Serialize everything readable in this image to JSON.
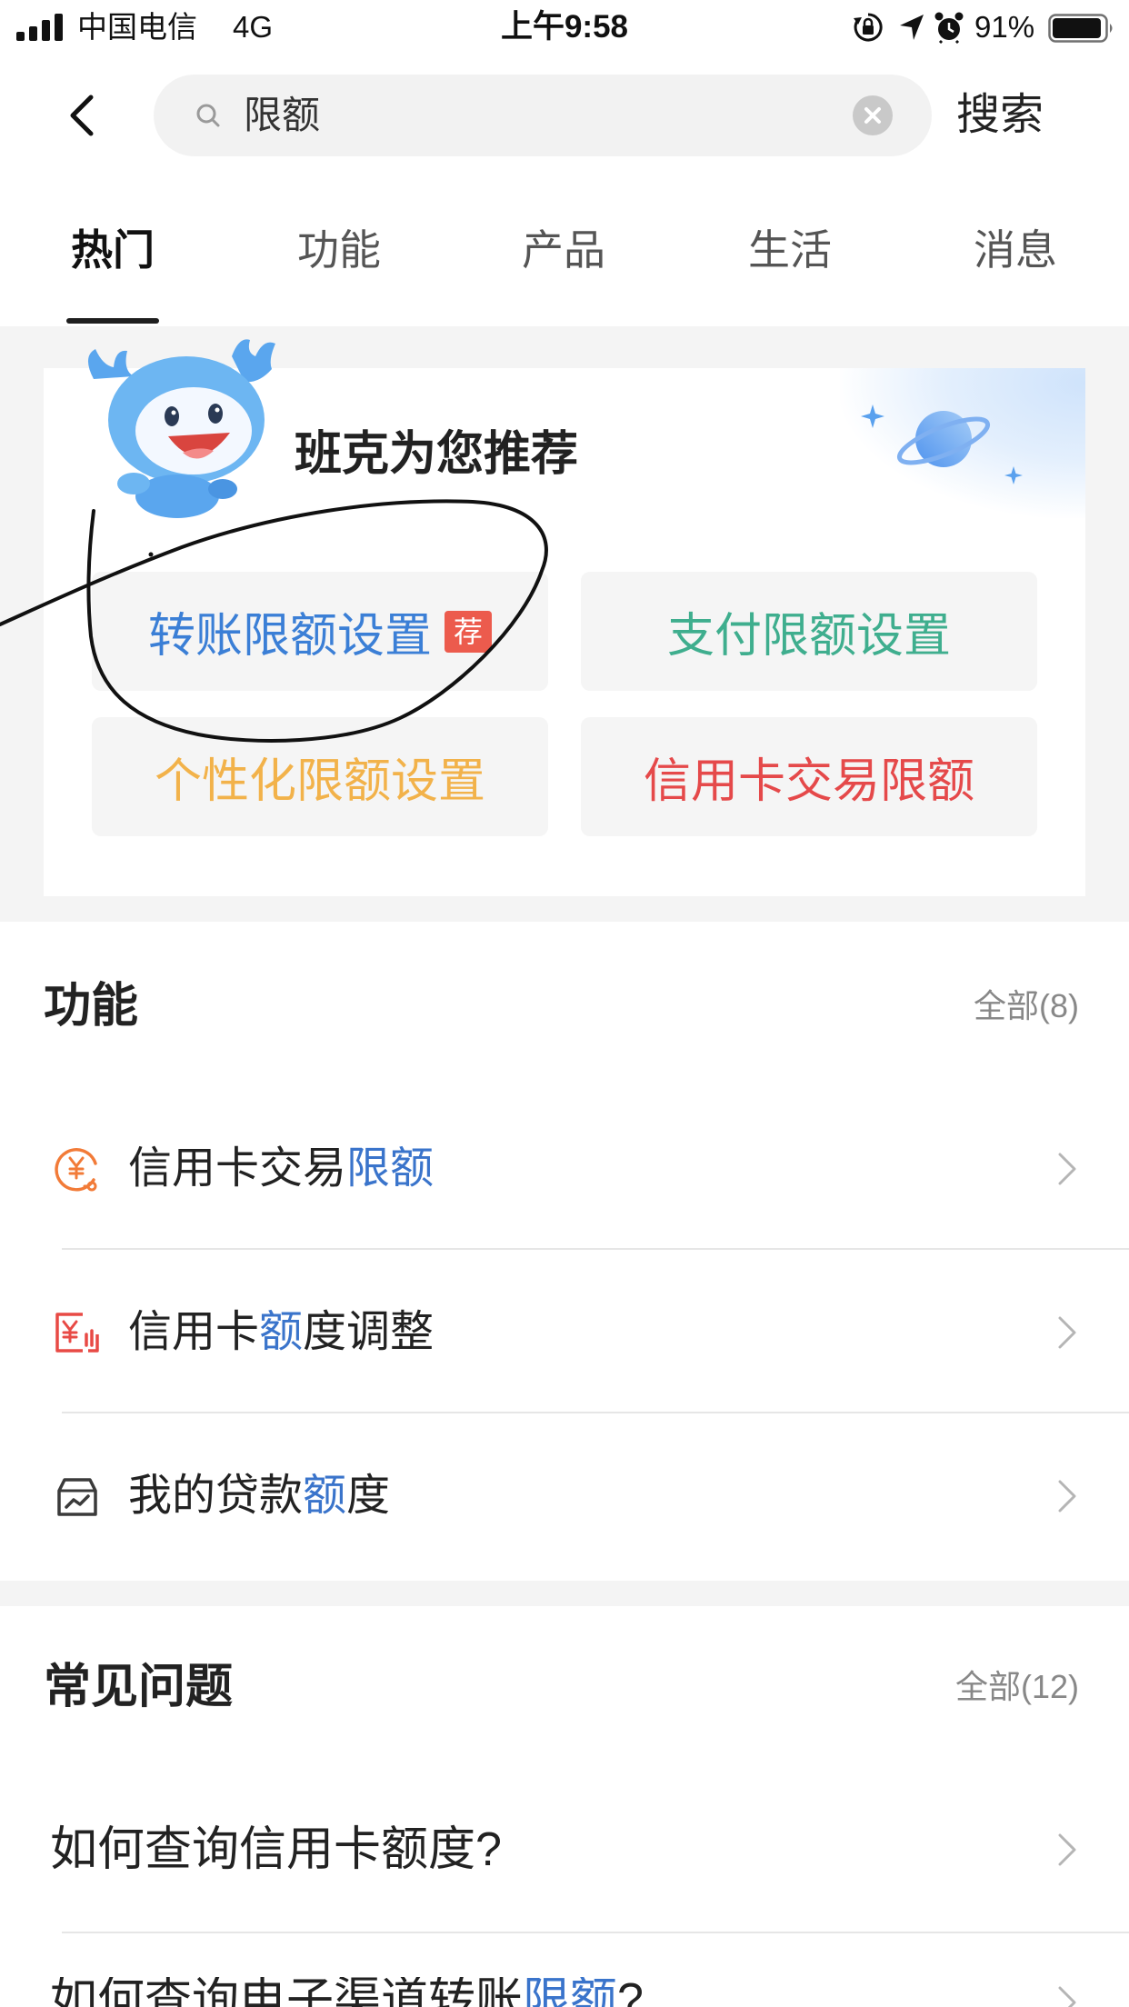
{
  "status_bar": {
    "carrier": "中国电信",
    "network": "4G",
    "time": "上午9:58",
    "battery": "91%",
    "icons": [
      "signal-icon",
      "orientation-lock-icon",
      "location-icon",
      "alarm-icon",
      "battery-icon"
    ]
  },
  "header": {
    "back_icon": "chevron-left-icon",
    "search": {
      "value": "限额",
      "icon": "search-icon",
      "clear_icon": "clear-icon"
    },
    "submit_label": "搜索"
  },
  "tabs": [
    {
      "label": "热门",
      "active": true
    },
    {
      "label": "功能"
    },
    {
      "label": "产品"
    },
    {
      "label": "生活"
    },
    {
      "label": "消息"
    }
  ],
  "recommend": {
    "title": "班克为您推荐",
    "mascot": "mascot-icon",
    "items": [
      {
        "label": "转账限额设置",
        "badge": "荐",
        "color": "#3b7fd6"
      },
      {
        "label": "支付限额设置",
        "color": "#3fae8e"
      },
      {
        "label": "个性化限额设置",
        "color": "#f2b24a"
      },
      {
        "label": "信用卡交易限额",
        "color": "#e5494a"
      }
    ]
  },
  "functions": {
    "title": "功能",
    "more": "全部(8)",
    "items": [
      {
        "icon": "credit-card-limit-icon",
        "parts": [
          "信用卡交易",
          "限额"
        ]
      },
      {
        "icon": "credit-quota-adjust-icon",
        "parts": [
          "信用卡",
          "额",
          "度调整"
        ]
      },
      {
        "icon": "loan-quota-icon",
        "parts": [
          "我的贷款",
          "额",
          "度"
        ]
      }
    ]
  },
  "faq": {
    "title": "常见问题",
    "more": "全部(12)",
    "items": [
      {
        "parts": [
          "如何查询信用卡额度?"
        ]
      },
      {
        "parts": [
          "如何查询电子渠道转账",
          "限额",
          "?"
        ]
      }
    ]
  },
  "colors": {
    "highlight": "#3a74cb",
    "badge": "#ec5b4d",
    "text": "#222222",
    "muted": "#888888",
    "page_gray": "#f4f4f4",
    "annotation": "#111111"
  }
}
